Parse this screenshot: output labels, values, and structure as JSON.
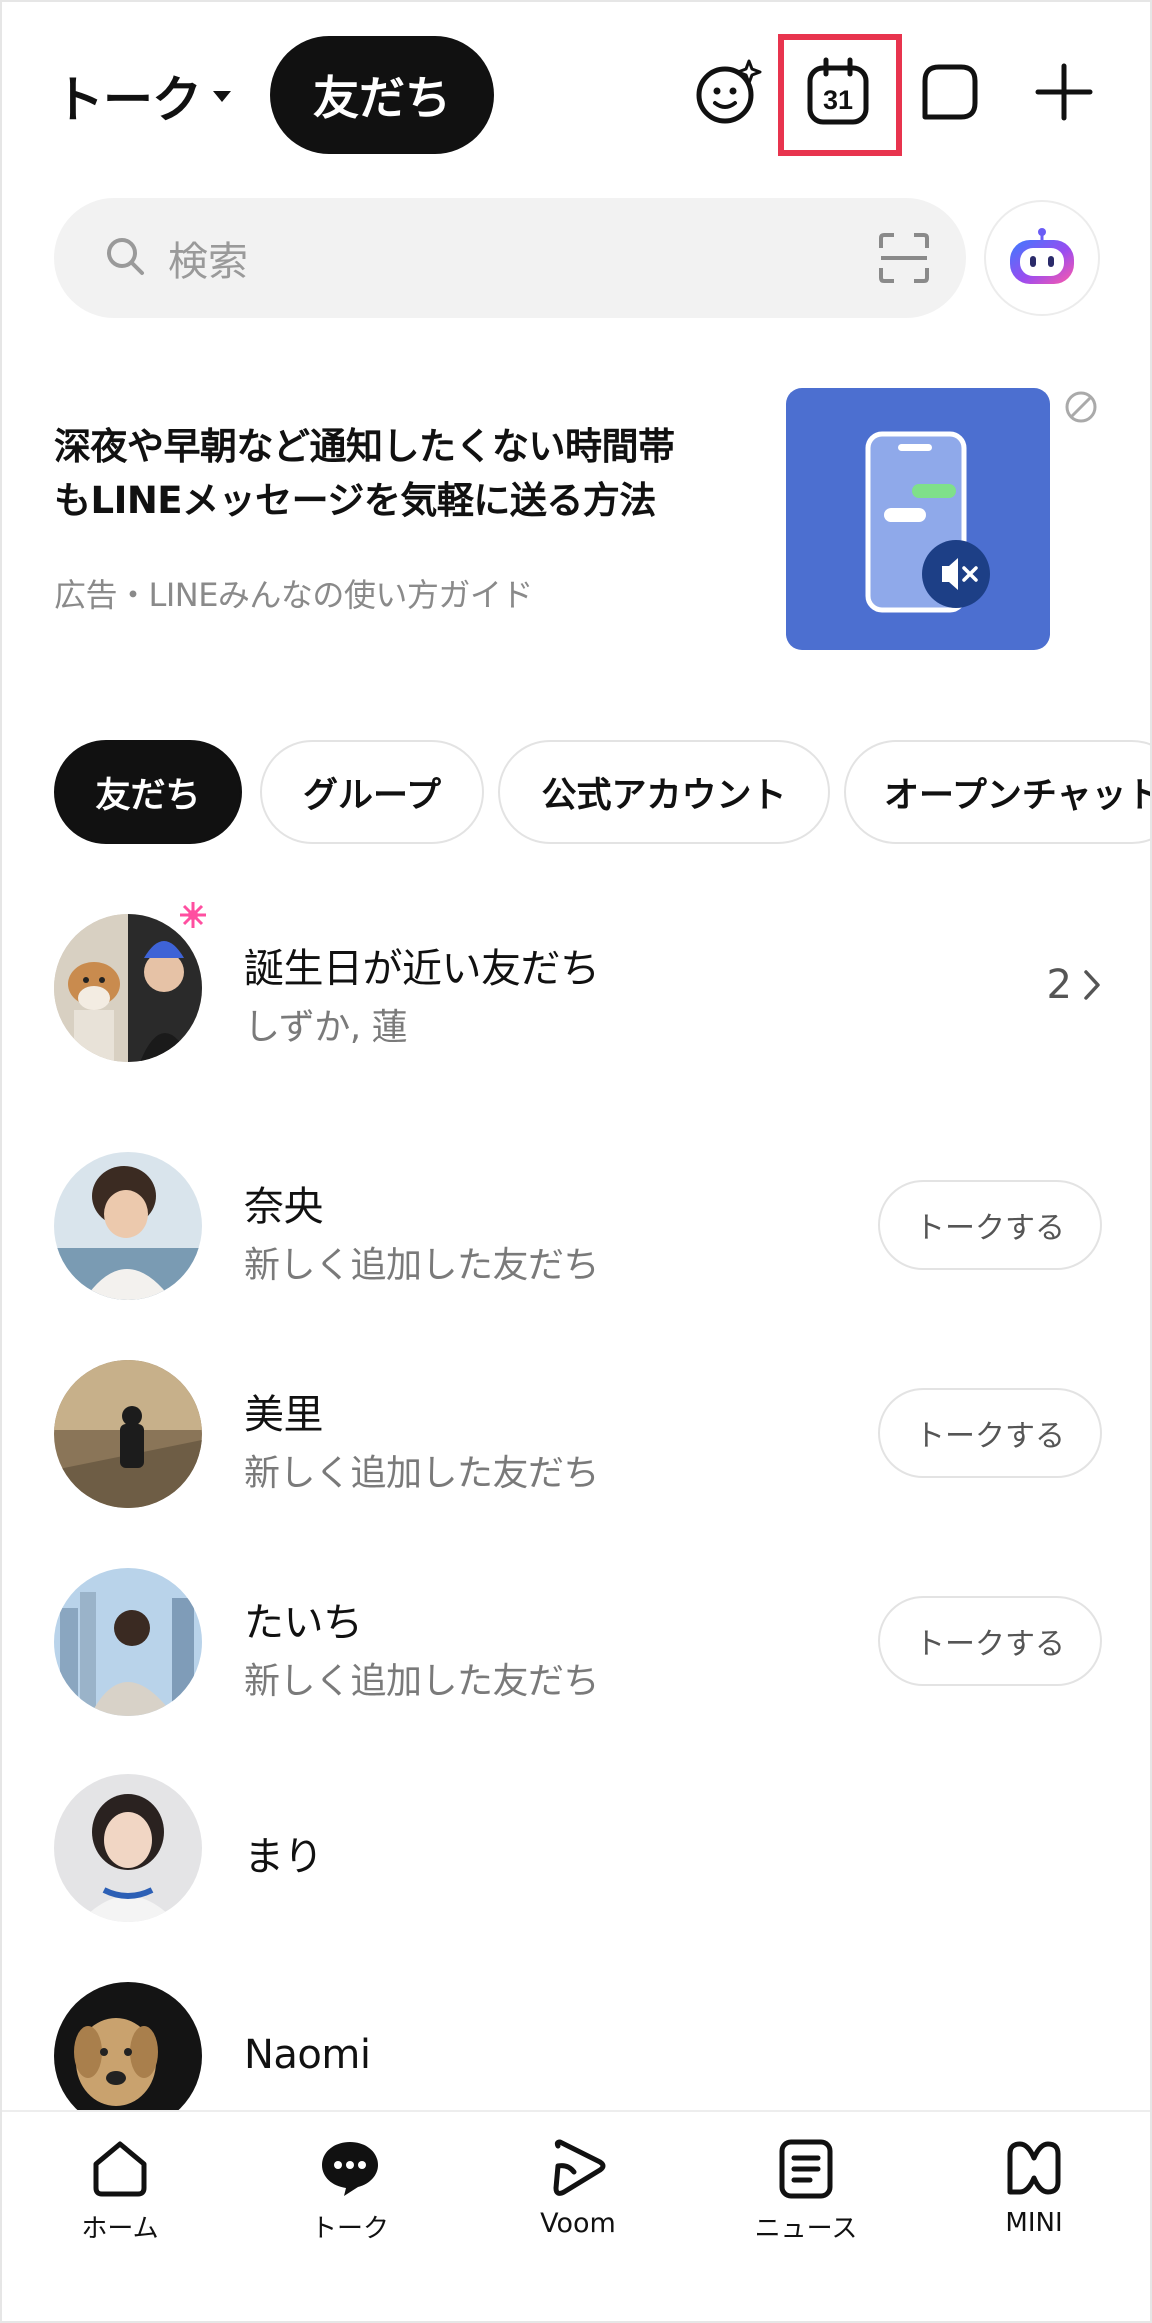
{
  "header": {
    "title": "トーク",
    "pill": "友だち",
    "calendar_day": "31",
    "icons": [
      "emoji-sparkle-icon",
      "calendar-icon",
      "chat-square-icon",
      "plus-icon"
    ]
  },
  "search": {
    "placeholder": "検索",
    "scan_icon": "qr-scan-icon",
    "assistant_icon": "ai-bot-icon"
  },
  "ad": {
    "title_line1": "深夜や早朝など通知したくない時間帯",
    "title_line2": "もLINEメッセージを気軽に送る方法",
    "sub": "広告・LINEみんなの使い方ガイド",
    "image_icon": "phone-mute-icon",
    "block_icon": "block-icon"
  },
  "tabs": [
    {
      "label": "友だち",
      "active": true
    },
    {
      "label": "グループ",
      "active": false
    },
    {
      "label": "公式アカウント",
      "active": false
    },
    {
      "label": "オープンチャット",
      "active": false
    }
  ],
  "birthday": {
    "name": "誕生日が近い友だち",
    "sub": "しずか, 蓮",
    "count": "2"
  },
  "friends": [
    {
      "name": "奈央",
      "sub": "新しく追加した友だち",
      "button": "トークする"
    },
    {
      "name": "美里",
      "sub": "新しく追加した友だち",
      "button": "トークする"
    },
    {
      "name": "たいち",
      "sub": "新しく追加した友だち",
      "button": "トークする"
    },
    {
      "name": "まり",
      "sub": "",
      "button": ""
    },
    {
      "name": "Naomi",
      "sub": "",
      "button": ""
    }
  ],
  "nav": [
    {
      "label": "ホーム",
      "icon": "home-icon"
    },
    {
      "label": "トーク",
      "icon": "chat-bubble-icon"
    },
    {
      "label": "Voom",
      "icon": "voom-play-icon"
    },
    {
      "label": "ニュース",
      "icon": "news-icon"
    },
    {
      "label": "MINI",
      "icon": "mini-icon"
    }
  ],
  "colors": {
    "accent_dark": "#111111",
    "highlight": "#e8344e",
    "ad_bg": "#4c6fd0"
  }
}
